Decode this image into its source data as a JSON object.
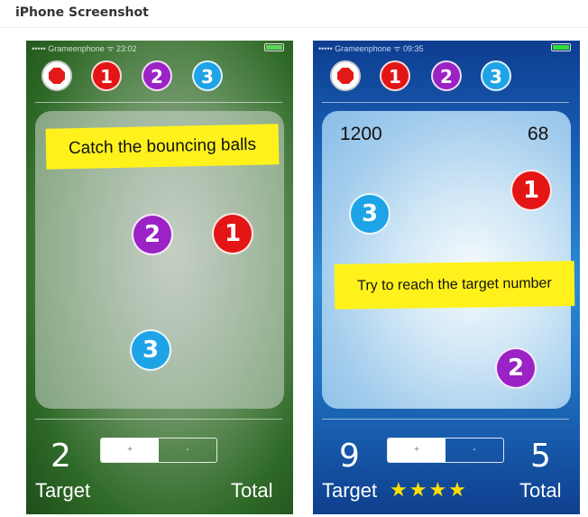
{
  "heading": "iPhone Screenshot",
  "screens": [
    {
      "status": {
        "carrier": "••••• Grameenphone ᯤ 23:02"
      },
      "buttons": [
        "1",
        "2",
        "3"
      ],
      "banner": "Catch the bouncing balls",
      "balls": [
        "2",
        "1",
        "3"
      ],
      "target_value": "2",
      "toggle": [
        "+",
        "-"
      ],
      "target_label": "Target",
      "total_label": "Total"
    },
    {
      "status": {
        "carrier": "••••• Grameenphone ᯤ 09:35"
      },
      "buttons": [
        "1",
        "2",
        "3"
      ],
      "score_left": "1200",
      "score_right": "68",
      "banner": "Try to reach the target number",
      "balls": [
        "1",
        "3",
        "2"
      ],
      "target_value": "9",
      "total_value": "5",
      "toggle": [
        "+",
        "-"
      ],
      "target_label": "Target",
      "total_label": "Total",
      "stars": "★★★★",
      "star_rating": 4
    }
  ],
  "colors": {
    "ball_red": "#e41515",
    "ball_purple": "#9b22c4",
    "ball_blue": "#1ea3e6",
    "banner_yellow": "#fff21c",
    "star_yellow": "#ffe000"
  },
  "icons": [
    "stop-icon",
    "signal-icon",
    "wifi-icon",
    "battery-icon",
    "star-icon"
  ]
}
